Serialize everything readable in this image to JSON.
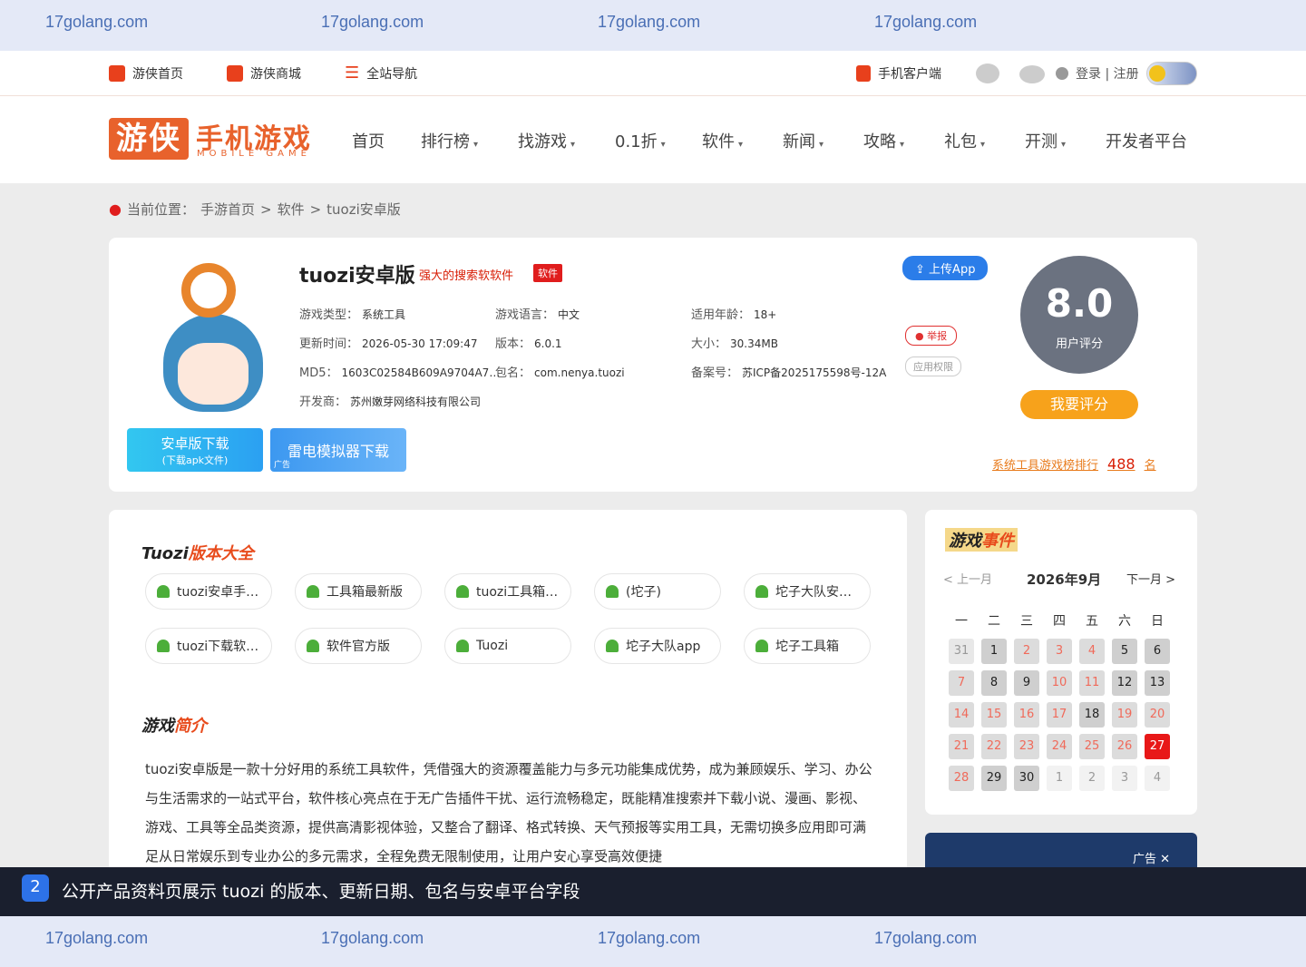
{
  "watermark": {
    "text": "17golang.com"
  },
  "topnav": {
    "home": "游侠首页",
    "mall": "游侠商城",
    "sitemap": "全站导航",
    "mobile_client": "手机客户端",
    "login": "登录 | 注册"
  },
  "logo": {
    "cn": "游侠",
    "title": "手机游戏",
    "sub": "MOBILE GAME"
  },
  "mainnav": {
    "items": [
      "首页",
      "排行榜",
      "找游戏",
      "0.1折",
      "软件",
      "新闻",
      "攻略",
      "礼包",
      "开测",
      "开发者平台"
    ],
    "caret": "▾"
  },
  "breadcrumb": {
    "label": "当前位置：",
    "home": "手游首页",
    "sep": ">",
    "cat": "软件",
    "current": "tuozi安卓版"
  },
  "app": {
    "title": "tuozi安卓版",
    "slogan": "强大的搜索软软件",
    "tag": "软件",
    "type_label": "游戏类型：",
    "type": "系统工具",
    "lang_label": "游戏语言：",
    "lang": "中文",
    "age_label": "适用年龄：",
    "age": "18+",
    "updated_label": "更新时间：",
    "updated": "2026-05-30 17:09:47",
    "version_label": "版本：",
    "version": "6.0.1",
    "size_label": "大小：",
    "size": "30.34MB",
    "md5_label": "MD5：",
    "md5": "1603C02584B609A9704A7…",
    "pkg_label": "包名：",
    "pkg": "com.nenya.tuozi",
    "icp_label": "备案号：",
    "icp": "苏ICP备2025175598号-12A",
    "dev_label": "开发商：",
    "dev": "苏州嫩芽网络科技有限公司"
  },
  "actions": {
    "upload": "上传App",
    "report": "举报",
    "permissions": "应用权限",
    "score": "8.0",
    "score_label": "用户评分",
    "rate": "我要评分",
    "rank_prefix": "系统工具游戏榜排行",
    "rank": "488",
    "rank_suffix": "名",
    "download_android": "安卓版下载",
    "download_android_sub": "(下载apk文件)",
    "download_leidian": "雷电模拟器下载",
    "ad_tag": "广告"
  },
  "versions": {
    "title_a": "Tuozi",
    "title_b": "版本大全",
    "items": [
      "tuozi安卓手…",
      "工具箱最新版",
      "tuozi工具箱…",
      "(坨子)",
      "坨子大队安…",
      "tuozi下载软…",
      "软件官方版",
      "Tuozi",
      "坨子大队app",
      "坨子工具箱"
    ]
  },
  "intro": {
    "title_a": "游戏",
    "title_b": "简介",
    "text": "tuozi安卓版是一款十分好用的系统工具软件，凭借强大的资源覆盖能力与多元功能集成优势，成为兼顾娱乐、学习、办公与生活需求的一站式平台，软件核心亮点在于无广告插件干扰、运行流畅稳定，既能精准搜索并下载小说、漫画、影视、游戏、工具等全品类资源，提供高清影视体验，又整合了翻译、格式转换、天气预报等实用工具，无需切换多应用即可满足从日常娱乐到专业办公的多元需求，全程免费无限制使用，让用户安心享受高效便捷"
  },
  "events": {
    "title_a": "游戏",
    "title_b": "事件",
    "prev": "<  上一月",
    "month": "2026年9月",
    "next": "下一月  >",
    "weekdays": [
      "一",
      "二",
      "三",
      "四",
      "五",
      "六",
      "日"
    ],
    "days": [
      "31",
      "1",
      "2",
      "3",
      "4",
      "5",
      "6",
      "7",
      "8",
      "9",
      "10",
      "11",
      "12",
      "13",
      "14",
      "15",
      "16",
      "17",
      "18",
      "19",
      "20",
      "21",
      "22",
      "23",
      "24",
      "25",
      "26",
      "27",
      "28",
      "29",
      "30",
      "1",
      "2",
      "3",
      "4"
    ],
    "today": "27",
    "ad_label": "广告 ✕"
  },
  "caption": {
    "num": "2",
    "text": "公开产品资料页展示 tuozi 的版本、更新日期、包名与安卓平台字段"
  },
  "colors": {
    "accent": "#e8622c",
    "red": "#d81e06",
    "blue": "#2b7de9",
    "orange": "#f7a21b"
  }
}
